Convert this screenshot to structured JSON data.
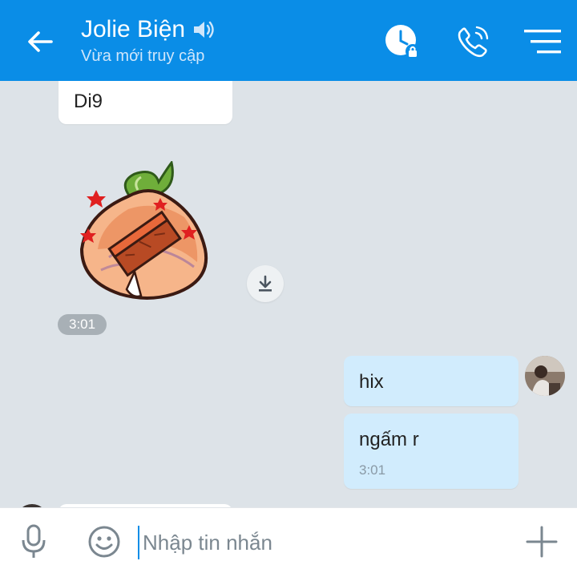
{
  "header": {
    "contact_name": "Jolie Biện",
    "status": "Vừa mới truy cập",
    "icons": {
      "back": "back-arrow-icon",
      "sound": "speaker-icon",
      "clock_lock": "clock-lock-icon",
      "call": "phone-call-icon",
      "menu": "menu-icon"
    }
  },
  "messages": [
    {
      "direction": "incoming",
      "type": "text",
      "text": "Di9"
    },
    {
      "direction": "incoming",
      "type": "sticker",
      "sticker": "onion-brick-sticker",
      "time": "3:01"
    },
    {
      "direction": "outgoing",
      "type": "text",
      "text": "hix"
    },
    {
      "direction": "outgoing",
      "type": "text",
      "text": "ngấm r",
      "time": "3:01"
    }
  ],
  "composer": {
    "placeholder": "Nhập tin nhắn",
    "icons": {
      "mic": "microphone-icon",
      "emoji": "emoji-icon",
      "add": "plus-icon"
    }
  },
  "colors": {
    "header_bg": "#0a8de7",
    "chat_bg": "#dde3e8",
    "incoming_bubble": "#ffffff",
    "outgoing_bubble": "#d1ecfd"
  }
}
